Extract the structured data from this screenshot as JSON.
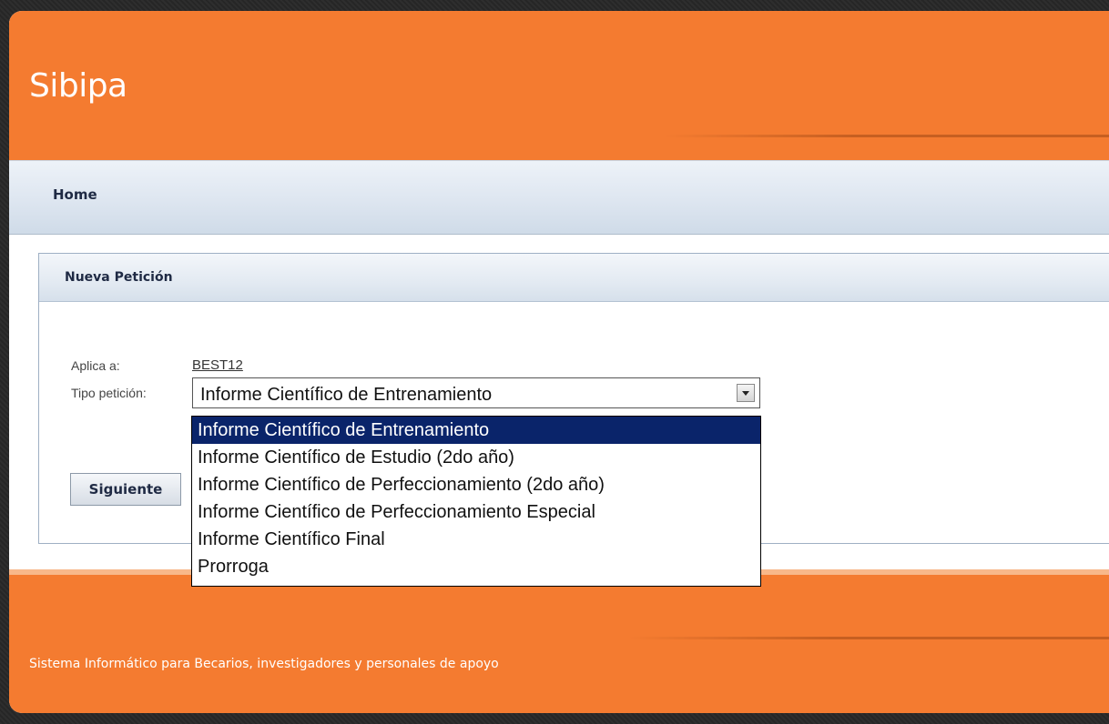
{
  "app": {
    "title": "Sibipa"
  },
  "nav": {
    "home_label": "Home"
  },
  "panel": {
    "title": "Nueva Petición"
  },
  "form": {
    "aplica_label": "Aplica a:",
    "aplica_value": "BEST12",
    "tipo_label": "Tipo petición:",
    "tipo_selected": "Informe Científico de Entrenamiento",
    "options": [
      "Informe Científico de Entrenamiento",
      "Informe Científico de Estudio (2do año)",
      "Informe Científico de Perfeccionamiento (2do año)",
      "Informe Científico de Perfeccionamiento Especial",
      "Informe Científico Final",
      "Prorroga"
    ],
    "next_button": "Siguiente"
  },
  "footer": {
    "text": "Sistema Informático para Becarios, investigadores y personales de apoyo"
  },
  "colors": {
    "brand_orange": "#f47b30",
    "selection_blue": "#0a246a"
  },
  "icons": {
    "dropdown": "chevron-down-icon"
  }
}
